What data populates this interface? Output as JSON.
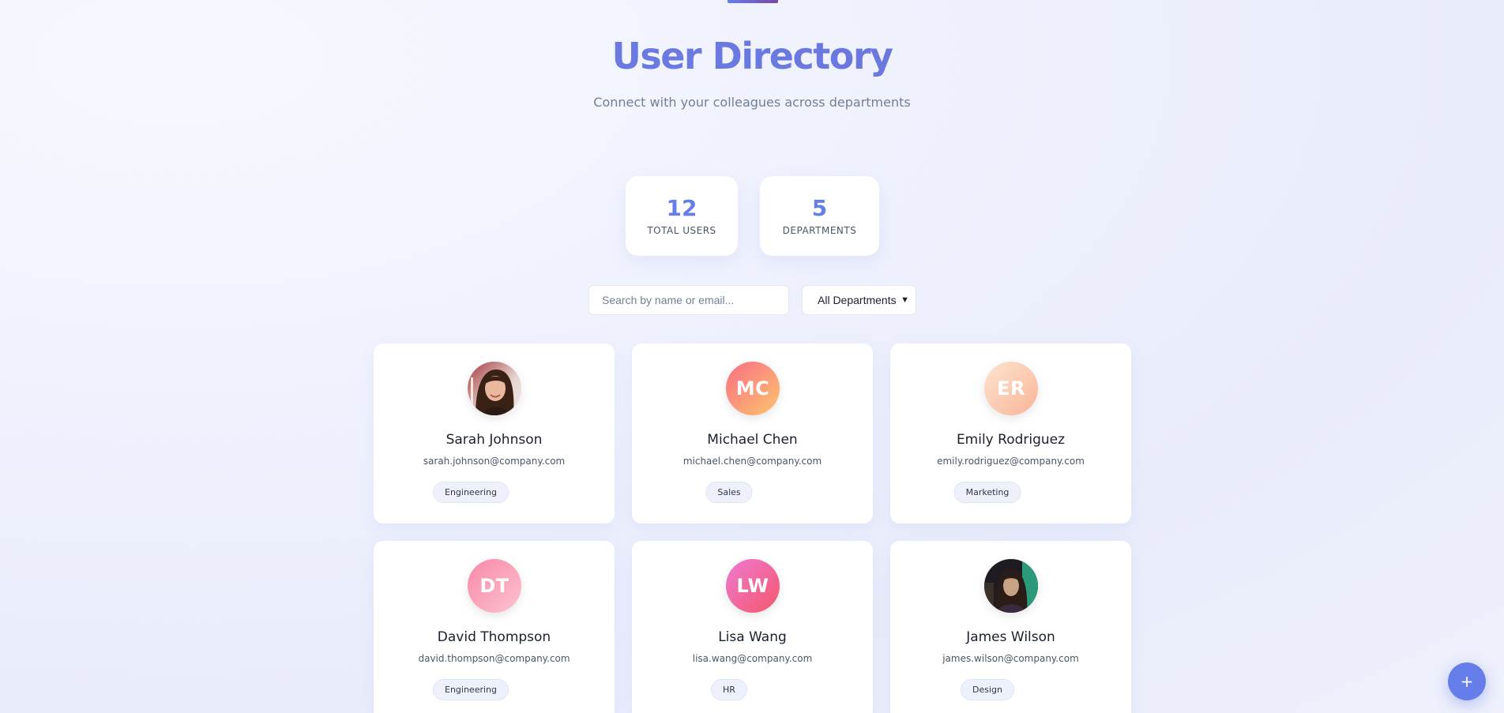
{
  "header": {
    "title": "User Directory",
    "subtitle": "Connect with your colleagues across departments"
  },
  "stats": {
    "total_users": {
      "value": "12",
      "label": "TOTAL USERS"
    },
    "departments": {
      "value": "5",
      "label": "DEPARTMENTS"
    }
  },
  "search": {
    "placeholder": "Search by name or email...",
    "value": ""
  },
  "department_filter": {
    "selected": "All Departments",
    "icon": "chevron-down-icon"
  },
  "users": [
    {
      "name": "Sarah Johnson",
      "email": "sarah.johnson@company.com",
      "department": "Engineering",
      "avatar": "photo"
    },
    {
      "name": "Michael Chen",
      "email": "michael.chen@company.com",
      "department": "Sales",
      "avatar": "initials",
      "initials": "MC"
    },
    {
      "name": "Emily Rodriguez",
      "email": "emily.rodriguez@company.com",
      "department": "Marketing",
      "avatar": "initials",
      "initials": "ER"
    },
    {
      "name": "David Thompson",
      "email": "david.thompson@company.com",
      "department": "Engineering",
      "avatar": "initials",
      "initials": "DT"
    },
    {
      "name": "Lisa Wang",
      "email": "lisa.wang@company.com",
      "department": "HR",
      "avatar": "initials",
      "initials": "LW"
    },
    {
      "name": "James Wilson",
      "email": "james.wilson@company.com",
      "department": "Design",
      "avatar": "photo"
    }
  ],
  "fab": {
    "label": "+",
    "icon": "plus-icon"
  },
  "colors": {
    "accent": "#667eea",
    "card": "#ffffff",
    "badge_bg": "#eef1fc"
  }
}
